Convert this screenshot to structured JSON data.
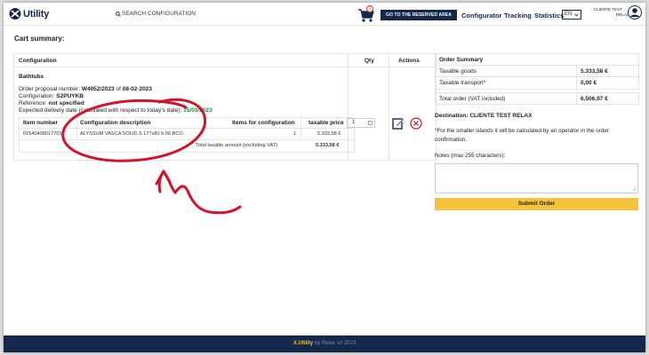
{
  "header": {
    "logo_text": "Utility",
    "search_label": "SEARCH CONFIGURATION",
    "cart_count": "1",
    "reserved_button": "GO TO THE RESERVED AREA",
    "nav": [
      "Configurator",
      "Tracking",
      "Statistics"
    ],
    "language": "EN",
    "user_line1": "CLIENTE TEST",
    "user_line2": "RELAX"
  },
  "page_title": "Cart summary:",
  "cart": {
    "columns": {
      "configuration": "Configuration",
      "qty": "Qty",
      "actions": "Actions"
    },
    "group": "Bathtubs",
    "order_label": "Order proposal number: ",
    "order_number": "W4052/2023",
    "order_of": " of ",
    "order_date": "08-02-2023",
    "config_label": "Configuration: ",
    "config_code": "S2PUYKB",
    "reference_label": "Reference: ",
    "reference_value": "not specified",
    "delivery_label": "Expected delivery date (calculated with respect to today's date): ",
    "delivery_date": "15/03/2023",
    "table": {
      "headers": [
        "Item number",
        "Configuration description",
        "Items for configuration",
        "taxable price"
      ],
      "row": {
        "item": "01540408017701",
        "description": "ALYSSUM VASCA SOLID.S 177x80 h.56 BCO",
        "items": "1",
        "price": "5.333,58 €"
      },
      "total_label": "Total taxable amount (excluding VAT)",
      "total_value": "5.333,58 €"
    },
    "qty_value": "1"
  },
  "summary": {
    "title": "Order Summary",
    "rows": [
      {
        "label": "Taxable goods",
        "value": "5.333,58 €"
      },
      {
        "label": "Taxable transport*",
        "value": "0,00 €"
      }
    ],
    "total_label": "Total order (VAT included)",
    "total_value": "6.506,97 €",
    "destination": "Destination: CLIENTE TEST RELAX",
    "note": "*For the smaller islands it will be calculated by an operator in the order confirmation.",
    "notes_label": "Notes (max 255 characters):",
    "submit": "Submit Order"
  },
  "footer": {
    "brand": "X.Utility",
    "text": " by Relax srl 2023"
  },
  "colors": {
    "navy": "#13284b",
    "accent": "#f6c13b",
    "annotation": "#d0142c",
    "delivery": "#1e8f3c"
  }
}
